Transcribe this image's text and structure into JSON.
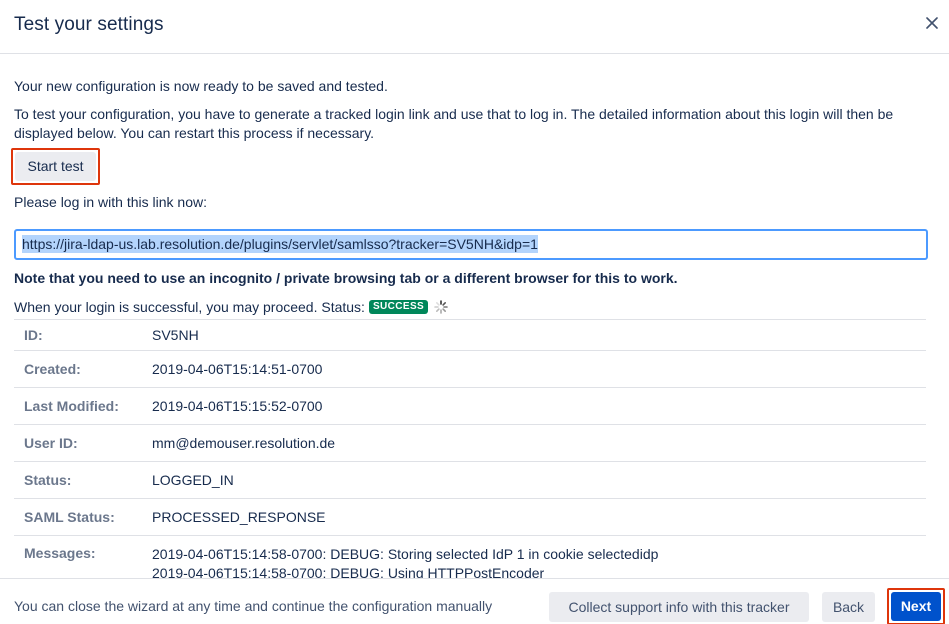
{
  "dialog": {
    "title": "Test your settings",
    "close_icon": "close-icon"
  },
  "content": {
    "intro": "Your new configuration is now ready to be saved and tested.",
    "instructions": "To test your configuration, you have to generate a tracked login link and use that to log in. The detailed information about this login will then be displayed below. You can restart this process if necessary.",
    "start_button": "Start test",
    "link_prompt": "Please log in with this link now:",
    "login_link": "https://jira-ldap-us.lab.resolution.de/plugins/servlet/samlsso?tracker=SV5NH&idp=1",
    "note": "Note that you need to use an incognito / private browsing tab or a different browser for this to work.",
    "status_prefix": "When your login is successful, you may proceed. Status:",
    "status_badge": "SUCCESS",
    "spinner_icon": "spinner-icon"
  },
  "details": [
    {
      "label": "ID:",
      "value": "SV5NH"
    },
    {
      "label": "Created:",
      "value": "2019-04-06T15:14:51-0700"
    },
    {
      "label": "Last Modified:",
      "value": "2019-04-06T15:15:52-0700"
    },
    {
      "label": "User ID:",
      "value": "mm@demouser.resolution.de"
    },
    {
      "label": "Status:",
      "value": "LOGGED_IN"
    },
    {
      "label": "SAML Status:",
      "value": "PROCESSED_RESPONSE"
    }
  ],
  "messages": {
    "label": "Messages:",
    "lines": [
      "2019-04-06T15:14:58-0700: DEBUG: Storing selected IdP 1 in cookie selectedidp",
      "2019-04-06T15:14:58-0700: DEBUG: Using HTTPPostEncoder"
    ]
  },
  "footer": {
    "text": "You can close the wizard at any time and continue the configuration manually",
    "collect_button": "Collect support info with this tracker",
    "back_button": "Back",
    "next_button": "Next"
  },
  "colors": {
    "badge_success": "#00875a",
    "primary": "#0052cc",
    "highlight_border": "#de350b",
    "focus_border": "#4c9aff"
  }
}
